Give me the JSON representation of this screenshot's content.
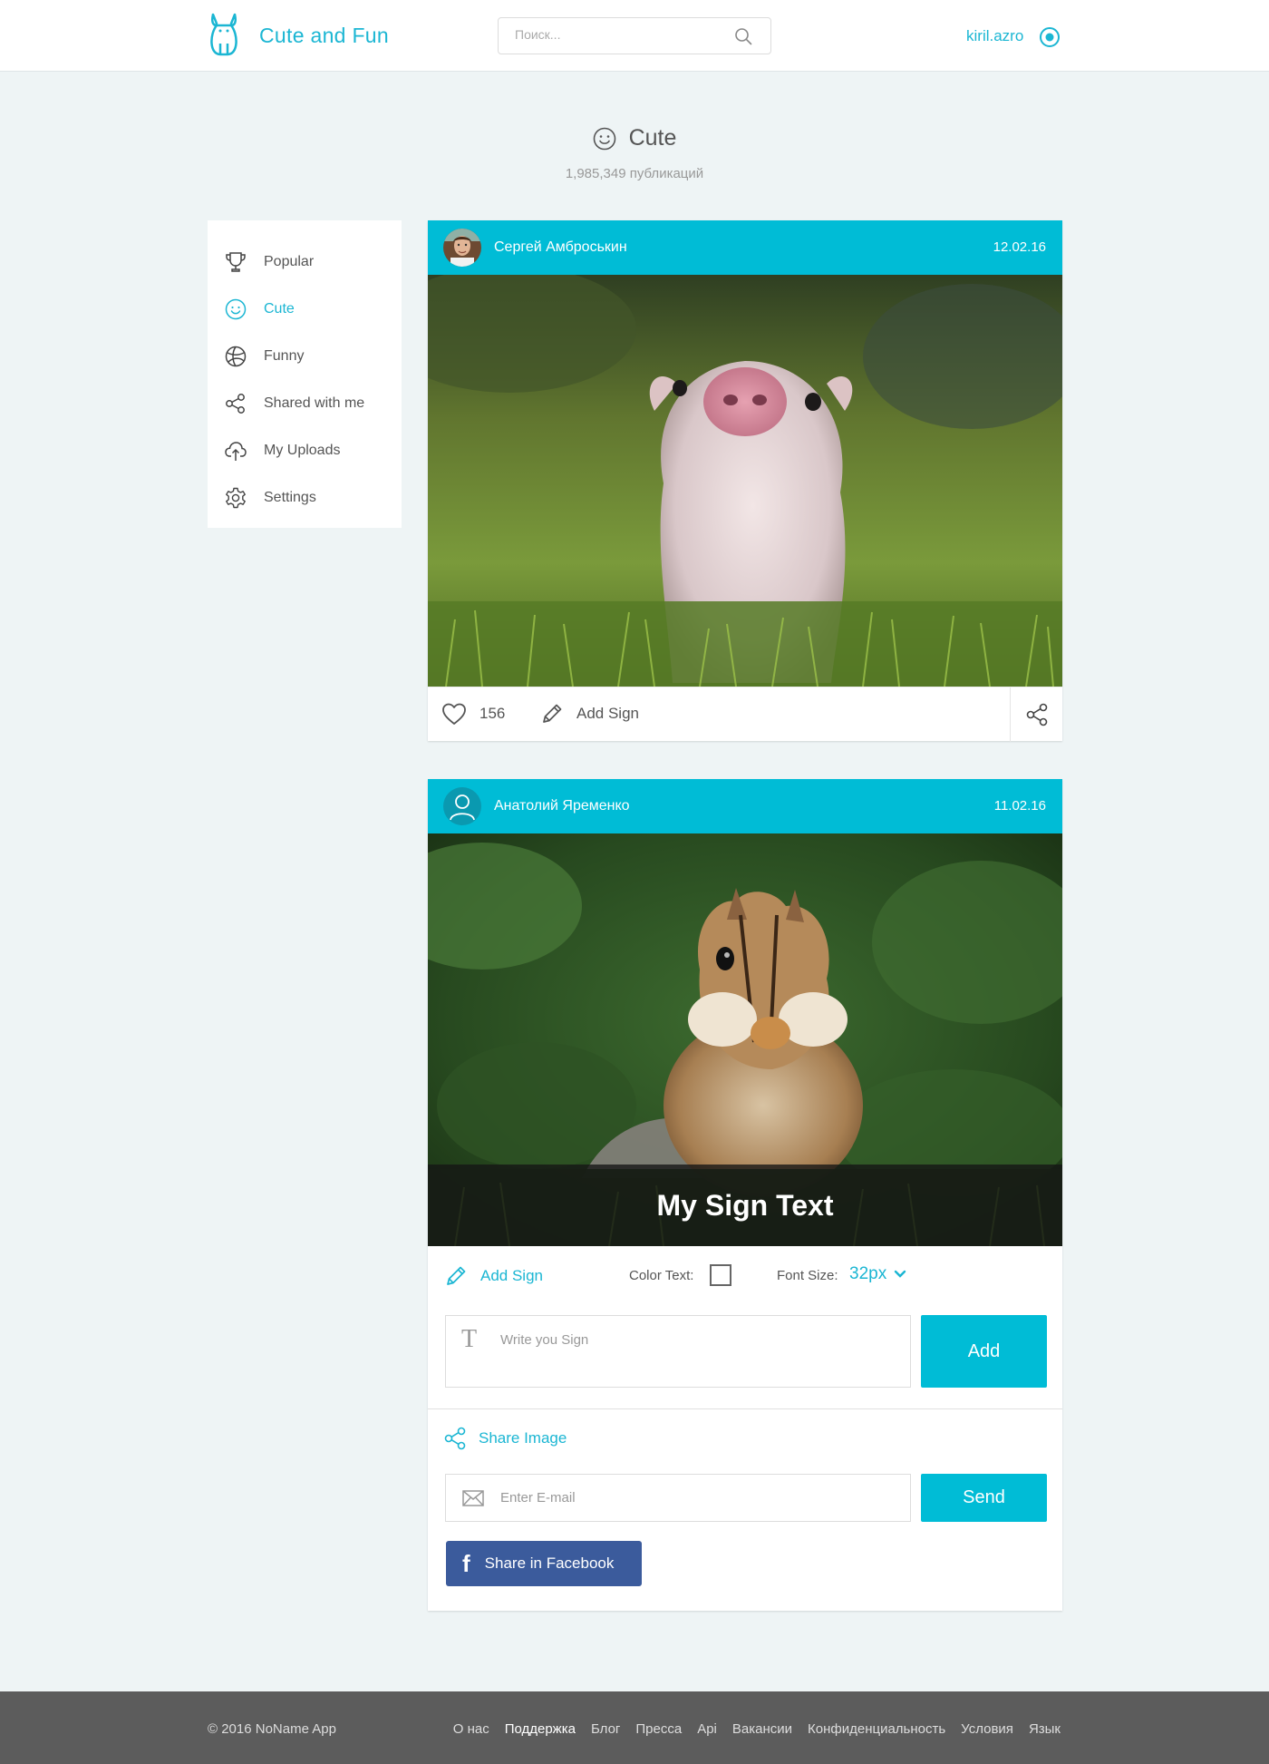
{
  "header": {
    "brand": "Cute and Fun",
    "search_placeholder": "Поиск...",
    "username": "kiril.azro"
  },
  "category": {
    "title": "Cute",
    "count": "1,985,349 публикаций"
  },
  "sidebar": {
    "items": [
      {
        "label": "Popular",
        "icon": "trophy-icon"
      },
      {
        "label": "Cute",
        "icon": "smile-icon",
        "active": true
      },
      {
        "label": "Funny",
        "icon": "basketball-icon"
      },
      {
        "label": "Shared with me",
        "icon": "share-icon"
      },
      {
        "label": "My Uploads",
        "icon": "cloud-upload-icon"
      },
      {
        "label": "Settings",
        "icon": "gear-icon"
      }
    ]
  },
  "posts": [
    {
      "author": "Сергей Амброськин",
      "date": "12.02.16",
      "image": "piglet-photo",
      "likes": "156",
      "add_sign": "Add Sign"
    },
    {
      "author": "Анатолий Яременко",
      "date": "11.02.16",
      "image": "chipmunk-photo",
      "sign_text": "My Sign Text",
      "editor": {
        "add_sign": "Add Sign",
        "color_text_label": "Color Text:",
        "font_size_label": "Font Size:",
        "font_size_value": "32px",
        "sign_placeholder": "Write you Sign",
        "add_button": "Add"
      },
      "share": {
        "title": "Share Image",
        "email_placeholder": "Enter E-mail",
        "send_button": "Send",
        "facebook_button": "Share in Facebook"
      }
    }
  ],
  "footer": {
    "copyright": "© 2016 NoName App",
    "links": [
      "О нас",
      "Поддержка",
      "Блог",
      "Пресса",
      "Api",
      "Вакансии",
      "Конфиденциальность",
      "Условия",
      "Язык"
    ],
    "active_link": "Поддержка"
  },
  "colors": {
    "accent": "#00bcd6",
    "facebook": "#3b5b9c",
    "footer_bg": "#5c5c5c",
    "page_bg": "#eef4f5"
  }
}
